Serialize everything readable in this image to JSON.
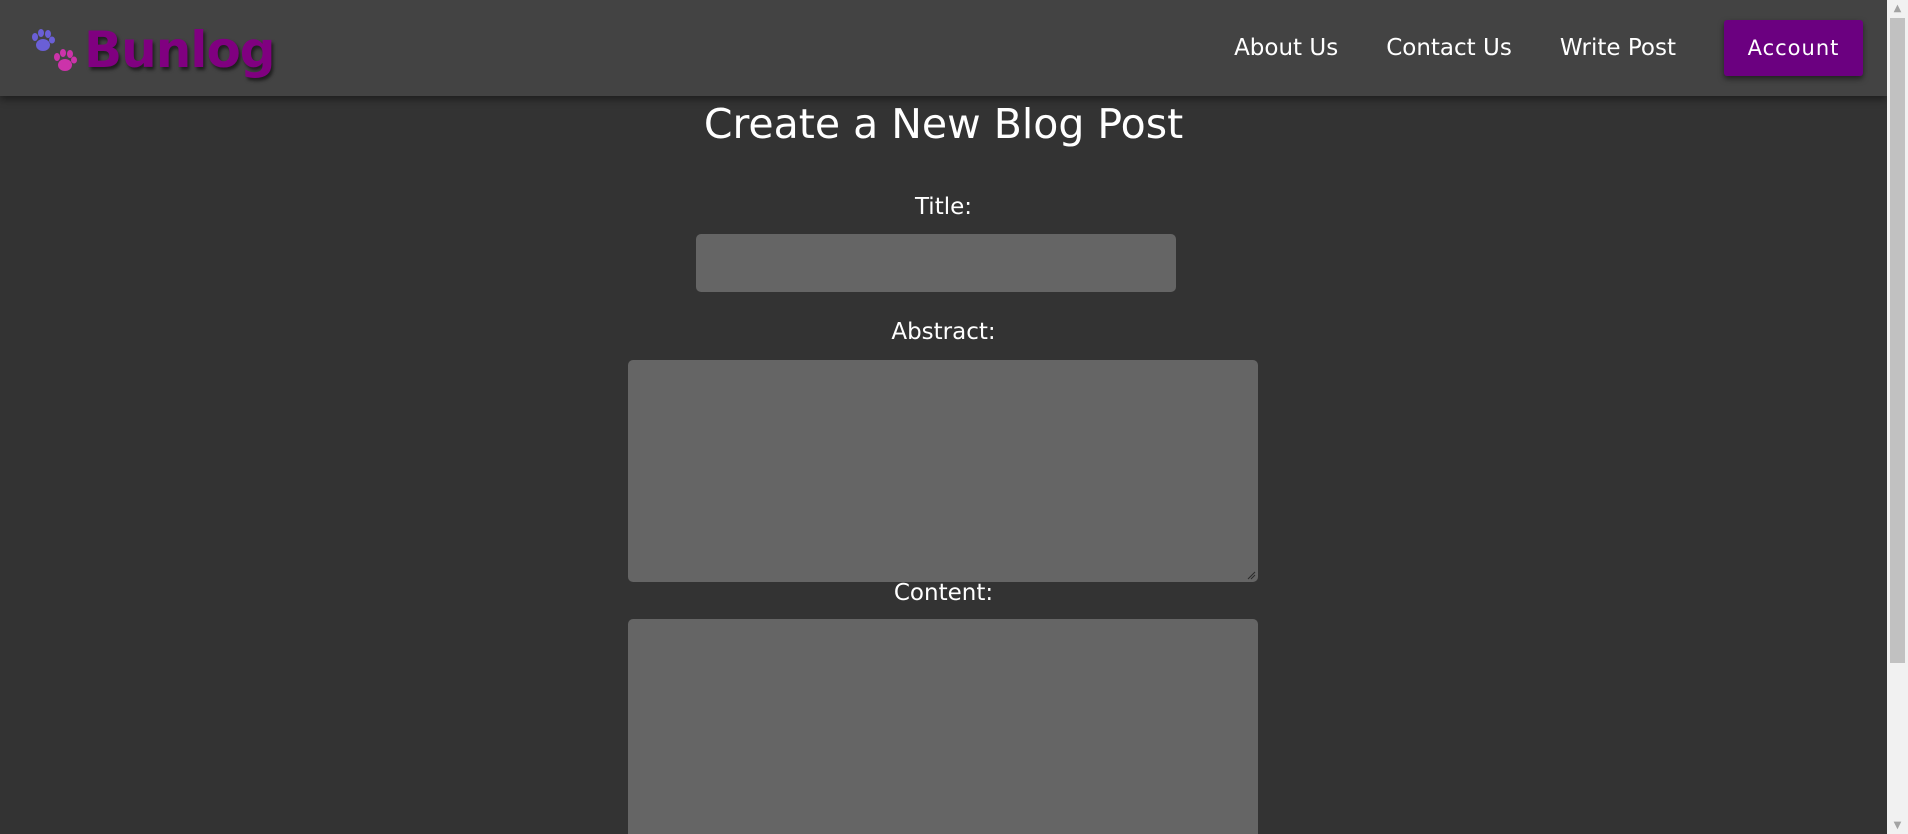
{
  "brand": {
    "name": "Bunlog",
    "color": "#800080"
  },
  "nav": {
    "links": [
      "About Us",
      "Contact Us",
      "Write Post"
    ],
    "account_label": "Account",
    "account_color": "#6b0080"
  },
  "page": {
    "title": "Create a New Blog Post"
  },
  "form": {
    "title_label": "Title:",
    "title_value": "",
    "abstract_label": "Abstract:",
    "abstract_value": "",
    "content_label": "Content:",
    "content_value": ""
  },
  "icons": {
    "logo": "paw-prints-icon",
    "scroll_up": "scroll-up-arrow",
    "scroll_down": "scroll-down-arrow",
    "resize": "resize-grip-icon"
  }
}
